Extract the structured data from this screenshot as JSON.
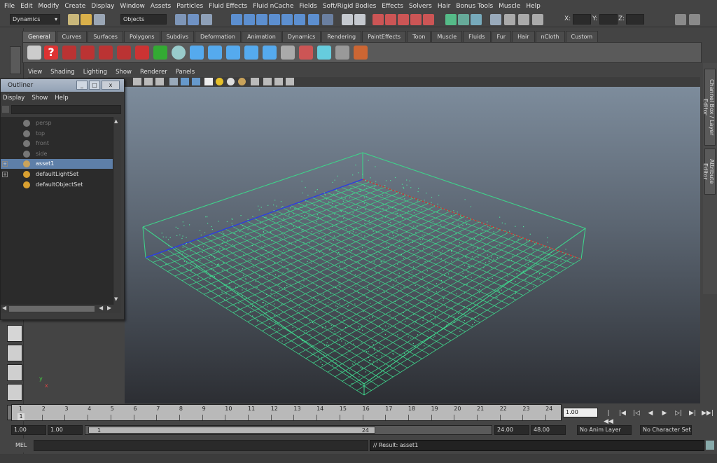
{
  "menubar": [
    "File",
    "Edit",
    "Modify",
    "Create",
    "Display",
    "Window",
    "Assets",
    "Particles",
    "Fluid Effects",
    "Fluid nCache",
    "Fields",
    "Soft/Rigid Bodies",
    "Effects",
    "Solvers",
    "Hair",
    "Bonus Tools",
    "Muscle",
    "Help"
  ],
  "statusline": {
    "menuset": "Dynamics",
    "selection_mode": "Objects",
    "x_label": "X:",
    "y_label": "Y:",
    "z_label": "Z:"
  },
  "shelf": {
    "tabs": [
      "General",
      "Curves",
      "Surfaces",
      "Polygons",
      "Subdivs",
      "Deformation",
      "Animation",
      "Dynamics",
      "Rendering",
      "PaintEffects",
      "Toon",
      "Muscle",
      "Fluids",
      "Fur",
      "Hair",
      "nCloth",
      "Custom"
    ],
    "active_tab": "General"
  },
  "viewport": {
    "menus": [
      "View",
      "Shading",
      "Lighting",
      "Show",
      "Renderer",
      "Panels"
    ],
    "axis_y": "y",
    "axis_x": "x"
  },
  "right_tabs": [
    "Channel Box / Layer Editor",
    "Attribute Editor"
  ],
  "outliner": {
    "title": "Outliner",
    "menus": [
      "Display",
      "Show",
      "Help"
    ],
    "items": [
      {
        "label": "persp",
        "state": "dim"
      },
      {
        "label": "top",
        "state": "dim"
      },
      {
        "label": "front",
        "state": "dim"
      },
      {
        "label": "side",
        "state": "dim"
      },
      {
        "label": "asset1",
        "state": "selected"
      },
      {
        "label": "defaultLightSet",
        "state": "normal"
      },
      {
        "label": "defaultObjectSet",
        "state": "normal"
      }
    ],
    "expand_symbol": "+"
  },
  "timeslider": {
    "ticks": [
      "1",
      "2",
      "3",
      "4",
      "5",
      "6",
      "7",
      "8",
      "9",
      "10",
      "11",
      "12",
      "13",
      "14",
      "15",
      "16",
      "17",
      "18",
      "19",
      "20",
      "21",
      "22",
      "23",
      "24"
    ],
    "current_frame": "1.00",
    "current_marker": "1"
  },
  "range": {
    "start": "1.00",
    "start2": "1.00",
    "slider_start": "1",
    "slider_end": "24",
    "end": "24.00",
    "end2": "48.00",
    "anim_layer": "No Anim Layer",
    "char_set": "No Character Set"
  },
  "cmd": {
    "lang": "MEL",
    "result": "// Result: asset1"
  }
}
